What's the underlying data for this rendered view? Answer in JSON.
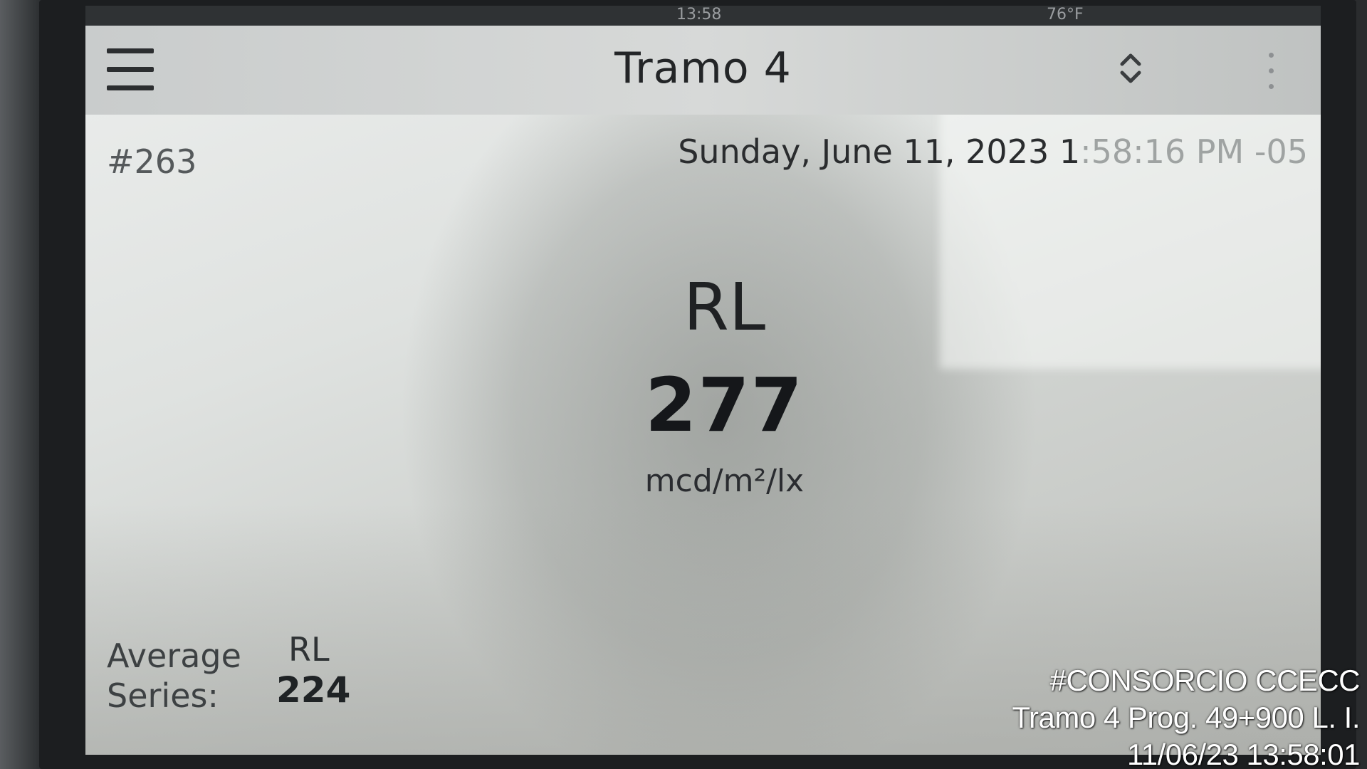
{
  "status_bar": {
    "time": "13:58",
    "temperature": "76°F"
  },
  "app_bar": {
    "menu_icon": "hamburger-menu-icon",
    "title": "Tramo 4",
    "sort_icon": "sort-updown-icon",
    "more_icon": "more-vertical-icon"
  },
  "record": {
    "number": "#263",
    "datetime_main": "Sunday, June 11, 2023 1",
    "datetime_tail": ":58:16 PM -05"
  },
  "reading": {
    "label": "RL",
    "value": "277",
    "unit": "mcd/m²/lx"
  },
  "average": {
    "label_line1": "Average",
    "label_line2": "Series:",
    "column": "RL",
    "value": "224"
  },
  "watermark": {
    "line1": "#CONSORCIO CCECC",
    "line2": "Tramo 4 Prog. 49+900 L. I.",
    "line3": "11/06/23  13:58:01"
  }
}
